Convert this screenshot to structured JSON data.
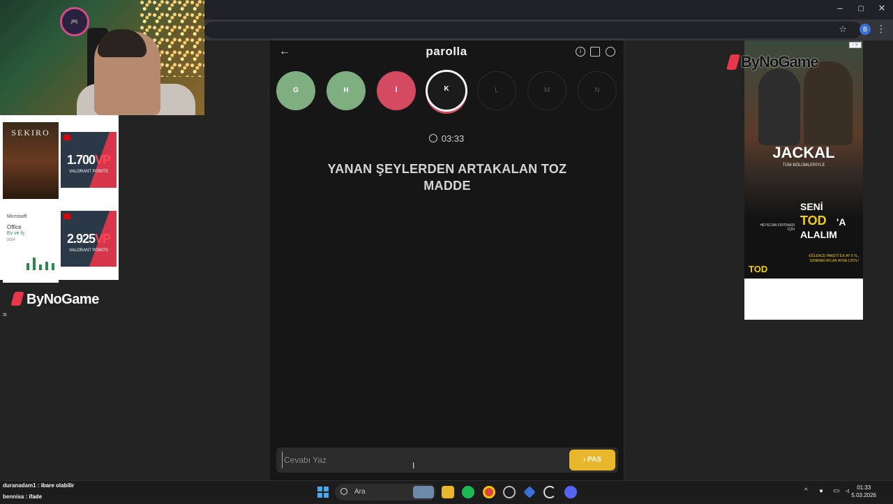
{
  "browser": {
    "minimize": "–",
    "restore": "▢",
    "close": "✕",
    "star": "☆",
    "profile_initial": "B",
    "menu": "⋮"
  },
  "game": {
    "logo": "parolla",
    "back_icon": "←",
    "icons": [
      "info-icon",
      "stats-icon",
      "user-icon"
    ],
    "letters": [
      {
        "letter": "G",
        "state": "correct"
      },
      {
        "letter": "H",
        "state": "correct"
      },
      {
        "letter": "İ",
        "state": "wrong"
      },
      {
        "letter": "K",
        "state": "current"
      },
      {
        "letter": "L",
        "state": "pending"
      },
      {
        "letter": "M",
        "state": "pending"
      },
      {
        "letter": "N",
        "state": "pending"
      }
    ],
    "timer": "03:33",
    "question": "YANAN ŞEYLERDEN ARTAKALAN TOZ MADDE",
    "answer_placeholder": "Cevabı Yaz",
    "pass_label": "PAS",
    "colors": {
      "correct": "#7fae80",
      "wrong": "#d44a60",
      "pass": "#e8b72c"
    }
  },
  "ad": {
    "title": "JACKAL",
    "subtitle": "TÜM BÖLÜMLERİYLE",
    "seni": "SENİ",
    "tod": "TOD",
    "a": "'A",
    "alalim": "ALALIM",
    "heyecan": "HEYECAN FIRTINASI İÇİN",
    "paket": "EĞLENCE PAKETİ İLK AY 9 TL, SONRAKİ AYLAR AYDA 129TL!",
    "tod_logo": "TOD"
  },
  "overlay": {
    "sponsor": "ByNoGame",
    "products": {
      "sekiro": "SEKIRO",
      "vp1_amount": "1.700",
      "vp2_amount": "2.925",
      "vp_suffix": "VP",
      "vp_sub": "VALORANT POINTS",
      "office_brand": "Microsoft",
      "office_title": "Office",
      "office_sub": "Ev ve İş",
      "office_year": "2024"
    },
    "chat": [
      {
        "user": "duranadam1",
        "msg": "ibare olabilir"
      },
      {
        "user": "bennisa",
        "msg": "ifade"
      }
    ]
  },
  "taskbar": {
    "search_label": "Ara",
    "time": "01:33",
    "date": "5.03.2026"
  }
}
